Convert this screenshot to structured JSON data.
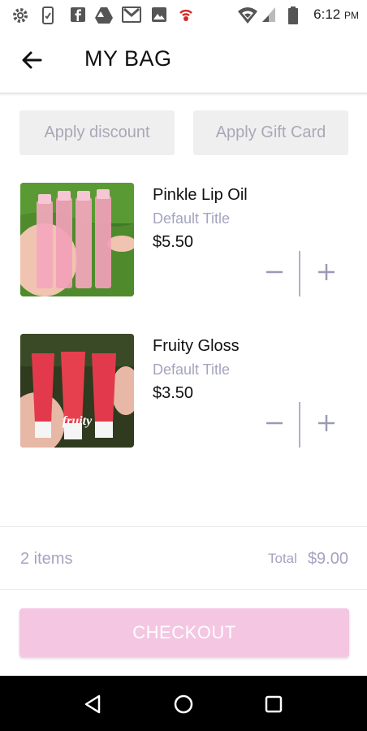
{
  "status_bar": {
    "time": "6:12",
    "period": "PM",
    "icons": [
      "settings-icon",
      "sim-icon",
      "facebook-icon",
      "drive-icon",
      "gmail-icon",
      "photos-icon",
      "alert-icon",
      "wifi-icon",
      "signal-icon",
      "battery-icon"
    ]
  },
  "header": {
    "title": "MY BAG",
    "back_icon": "arrow-left-icon"
  },
  "actions": {
    "discount_label": "Apply discount",
    "gift_card_label": "Apply Gift Card"
  },
  "cart": {
    "items": [
      {
        "name": "Pinkle Lip Oil",
        "variant": "Default Title",
        "price": "$5.50",
        "image_label": ""
      },
      {
        "name": "Fruity Gloss",
        "variant": "Default Title",
        "price": "$3.50",
        "image_label": "fruity"
      }
    ]
  },
  "summary": {
    "item_count": "2 items",
    "total_label": "Total",
    "total_value": "$9.00"
  },
  "checkout": {
    "label": "CHECKOUT"
  },
  "colors": {
    "accent": "#f4c6e2",
    "muted_text": "#a4a4c0",
    "button_bg": "#efefef"
  },
  "nav_bar": {
    "icons": [
      "back-triangle-icon",
      "home-circle-icon",
      "recents-square-icon"
    ]
  }
}
